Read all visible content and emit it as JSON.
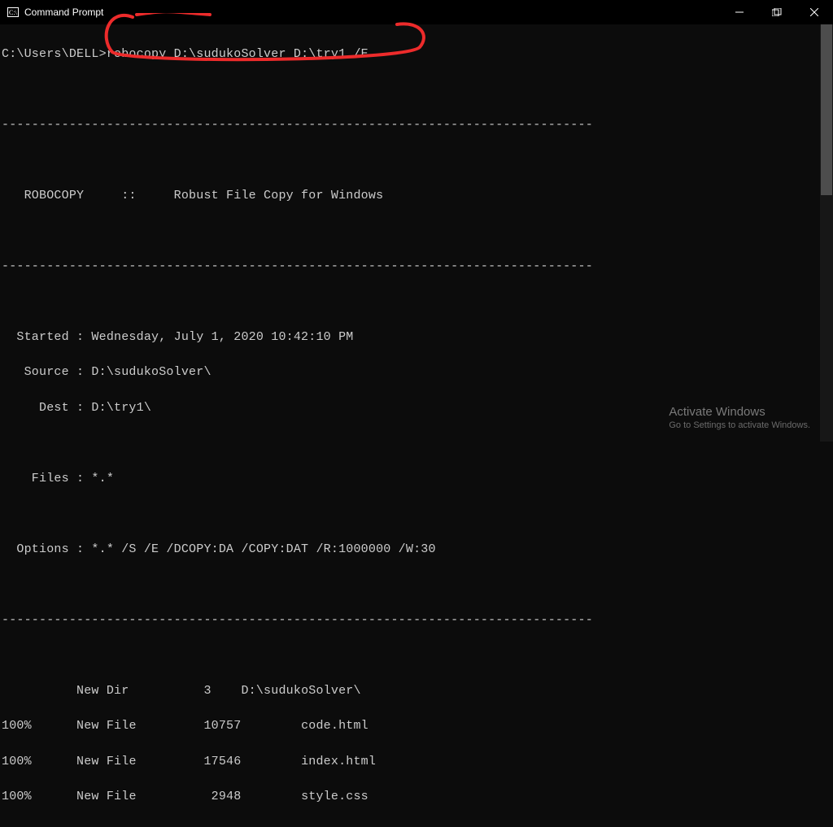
{
  "window": {
    "title": "Command Prompt"
  },
  "prompt": {
    "path": "C:\\Users\\DELL>",
    "command": "robocopy D:\\sudukoSolver D:\\try1 /E"
  },
  "divider": "-------------------------------------------------------------------------------",
  "header": {
    "label": "   ROBOCOPY     ::     Robust File Copy for Windows"
  },
  "info": {
    "started": "  Started : Wednesday, July 1, 2020 10:42:10 PM",
    "source": "   Source : D:\\sudukoSolver\\",
    "dest": "     Dest : D:\\try1\\",
    "files": "    Files : *.*",
    "options": "  Options : *.* /S /E /DCOPY:DA /COPY:DAT /R:1000000 /W:30"
  },
  "results": {
    "dirline": "\t  New Dir          3\tD:\\sudukoSolver\\",
    "row1": "100%\t  New File  \t   10757\tcode.html",
    "row2": "100%\t  New File  \t   17546\tindex.html",
    "row3": "100%\t  New File  \t    2948\tstyle.css"
  },
  "watermark": {
    "title": "Activate Windows",
    "sub": "Go to Settings to activate Windows."
  }
}
